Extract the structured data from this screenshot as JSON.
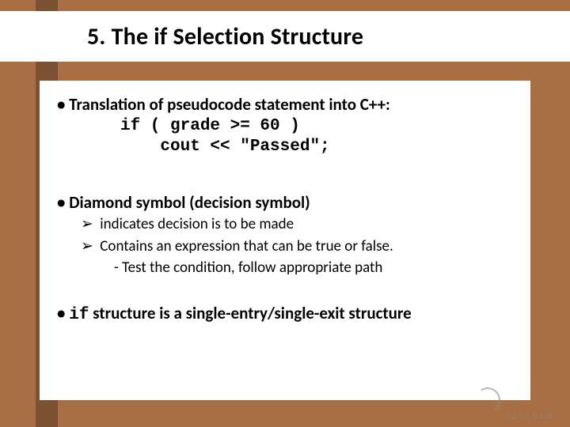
{
  "title": "5.  The if Selection Structure",
  "bullets": {
    "line1": "• Translation of pseudocode statement into C++:",
    "code": "if ( grade >= 60 )\n    cout << \"Passed\";",
    "line2": "• Diamond symbol (decision symbol)",
    "sub1": "indicates decision is to be made",
    "sub2": "Contains an expression that can be true or false.",
    "sub2a": "-   Test the condition, follow appropriate path",
    "line3_prefix": "•   ",
    "line3_mono": "if",
    "line3_rest": " structure is a single-entry/single-exit structure"
  },
  "glyphs": {
    "arrow": "➢"
  },
  "logo": {
    "text": "contoso"
  }
}
